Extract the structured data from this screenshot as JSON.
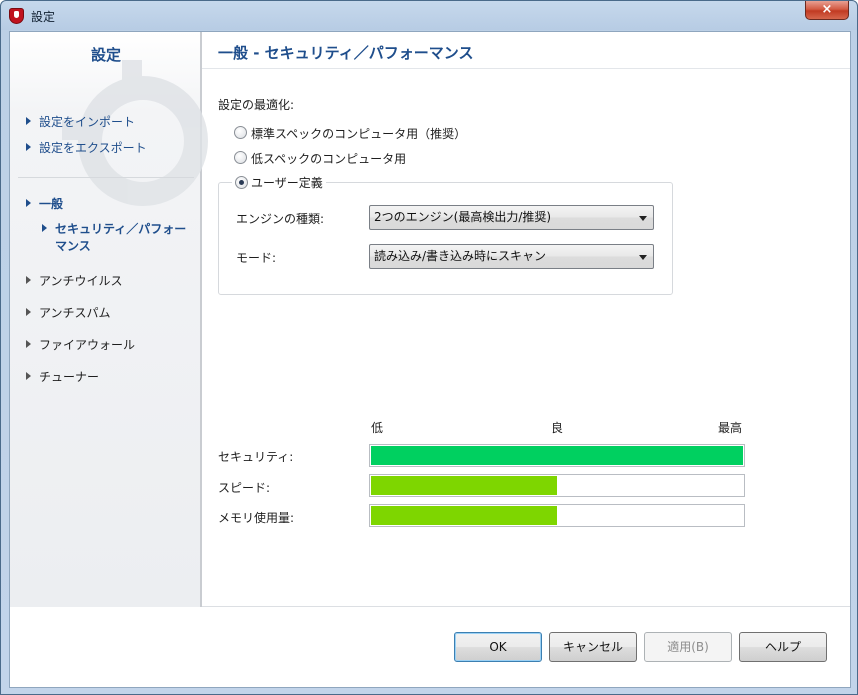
{
  "window": {
    "title": "設定",
    "close_label": "×"
  },
  "sidebar": {
    "title": "設定",
    "links": [
      {
        "label": "設定をインポート"
      },
      {
        "label": "設定をエクスポート"
      }
    ],
    "tree": [
      {
        "label": "一般"
      },
      {
        "label_line1": "セキュリティ／パフォー",
        "label_line2": "マンス"
      },
      {
        "label": "アンチウイルス"
      },
      {
        "label": "アンチスパム"
      },
      {
        "label": "ファイアウォール"
      },
      {
        "label": "チューナー"
      }
    ]
  },
  "main": {
    "title": "一般 - セキュリティ／パフォーマンス",
    "optimize_label": "設定の最適化:",
    "radio_options": [
      {
        "label": "標準スペックのコンピュータ用（推奨）",
        "checked": false
      },
      {
        "label": "低スペックのコンピュータ用",
        "checked": false
      },
      {
        "label": "ユーザー定義",
        "checked": true
      }
    ],
    "engine_label": "エンジンの種類:",
    "engine_value": "2つのエンジン(最高検出力/推奨)",
    "mode_label": "モード:",
    "mode_value": "読み込み/書き込み時にスキャン"
  },
  "performance": {
    "scale_low": "低",
    "scale_mid": "良",
    "scale_high": "最高",
    "rows": [
      {
        "label": "セキュリティ:",
        "level": 1.0,
        "color": "#00d060"
      },
      {
        "label": "スピード:",
        "level": 0.5,
        "color": "#7ed600"
      },
      {
        "label": "メモリ使用量:",
        "level": 0.5,
        "color": "#7ed600"
      }
    ]
  },
  "buttons": {
    "ok": "OK",
    "cancel": "キャンセル",
    "apply": "適用(B)",
    "help": "ヘルプ"
  }
}
